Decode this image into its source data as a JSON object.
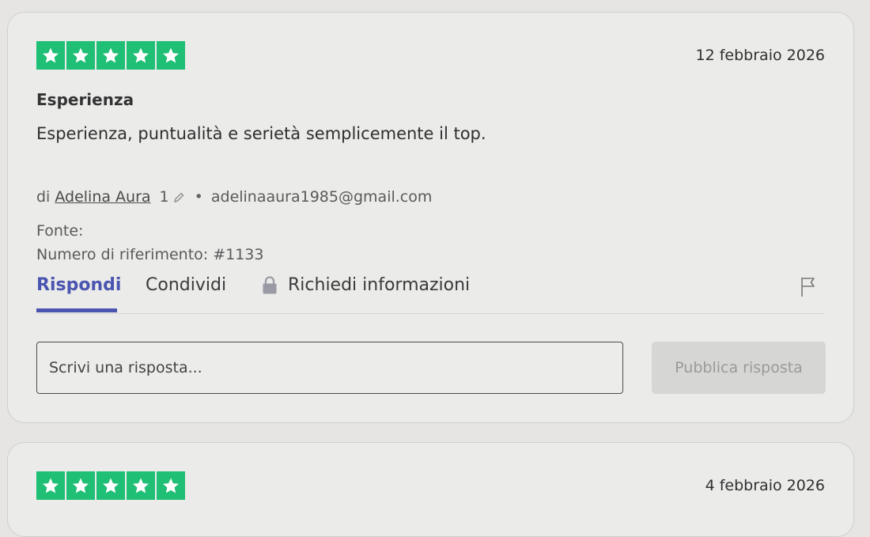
{
  "reviews": [
    {
      "rating": 5,
      "date": "12 febbraio 2026",
      "title": "Esperienza",
      "body": "Esperienza, puntualità e serietà semplicemente il top.",
      "by_prefix": "di",
      "author": "Adelina Aura",
      "review_count": "1",
      "email": "adelinaaura1985@gmail.com",
      "source_label": "Fonte:",
      "reference": "Numero di riferimento: #1133",
      "tabs": {
        "reply": "Rispondi",
        "share": "Condividi",
        "request_info": "Richiedi informazioni"
      },
      "reply_placeholder": "Scrivi una risposta...",
      "publish_label": "Pubblica risposta"
    },
    {
      "rating": 5,
      "date": "4 febbraio 2026"
    }
  ],
  "colors": {
    "star_green": "#1fbf75",
    "accent": "#4a55b0",
    "card_bg": "#ebebea"
  },
  "icons": [
    "star-icon",
    "pencil-icon",
    "lock-icon",
    "flag-icon"
  ]
}
